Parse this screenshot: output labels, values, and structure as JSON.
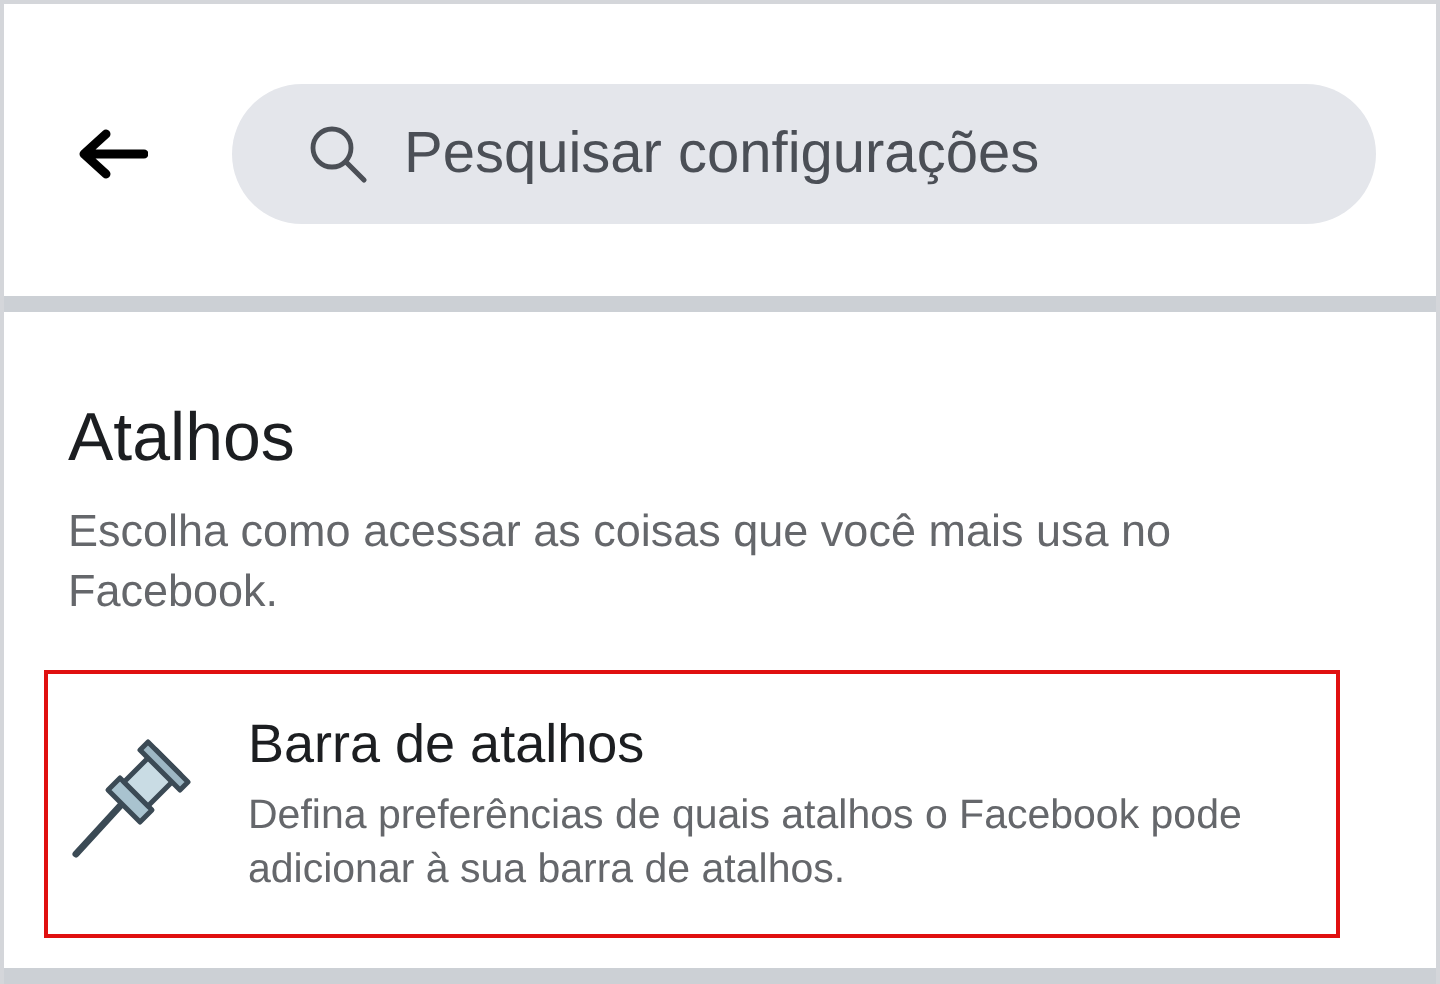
{
  "search": {
    "placeholder": "Pesquisar configurações"
  },
  "section": {
    "title": "Atalhos",
    "description": "Escolha como acessar as coisas que você mais usa no Facebook.",
    "items": [
      {
        "title": "Barra de atalhos",
        "description": "Defina preferências de quais atalhos o Facebook pode adicionar à sua barra de atalhos.",
        "highlighted": true
      }
    ]
  }
}
